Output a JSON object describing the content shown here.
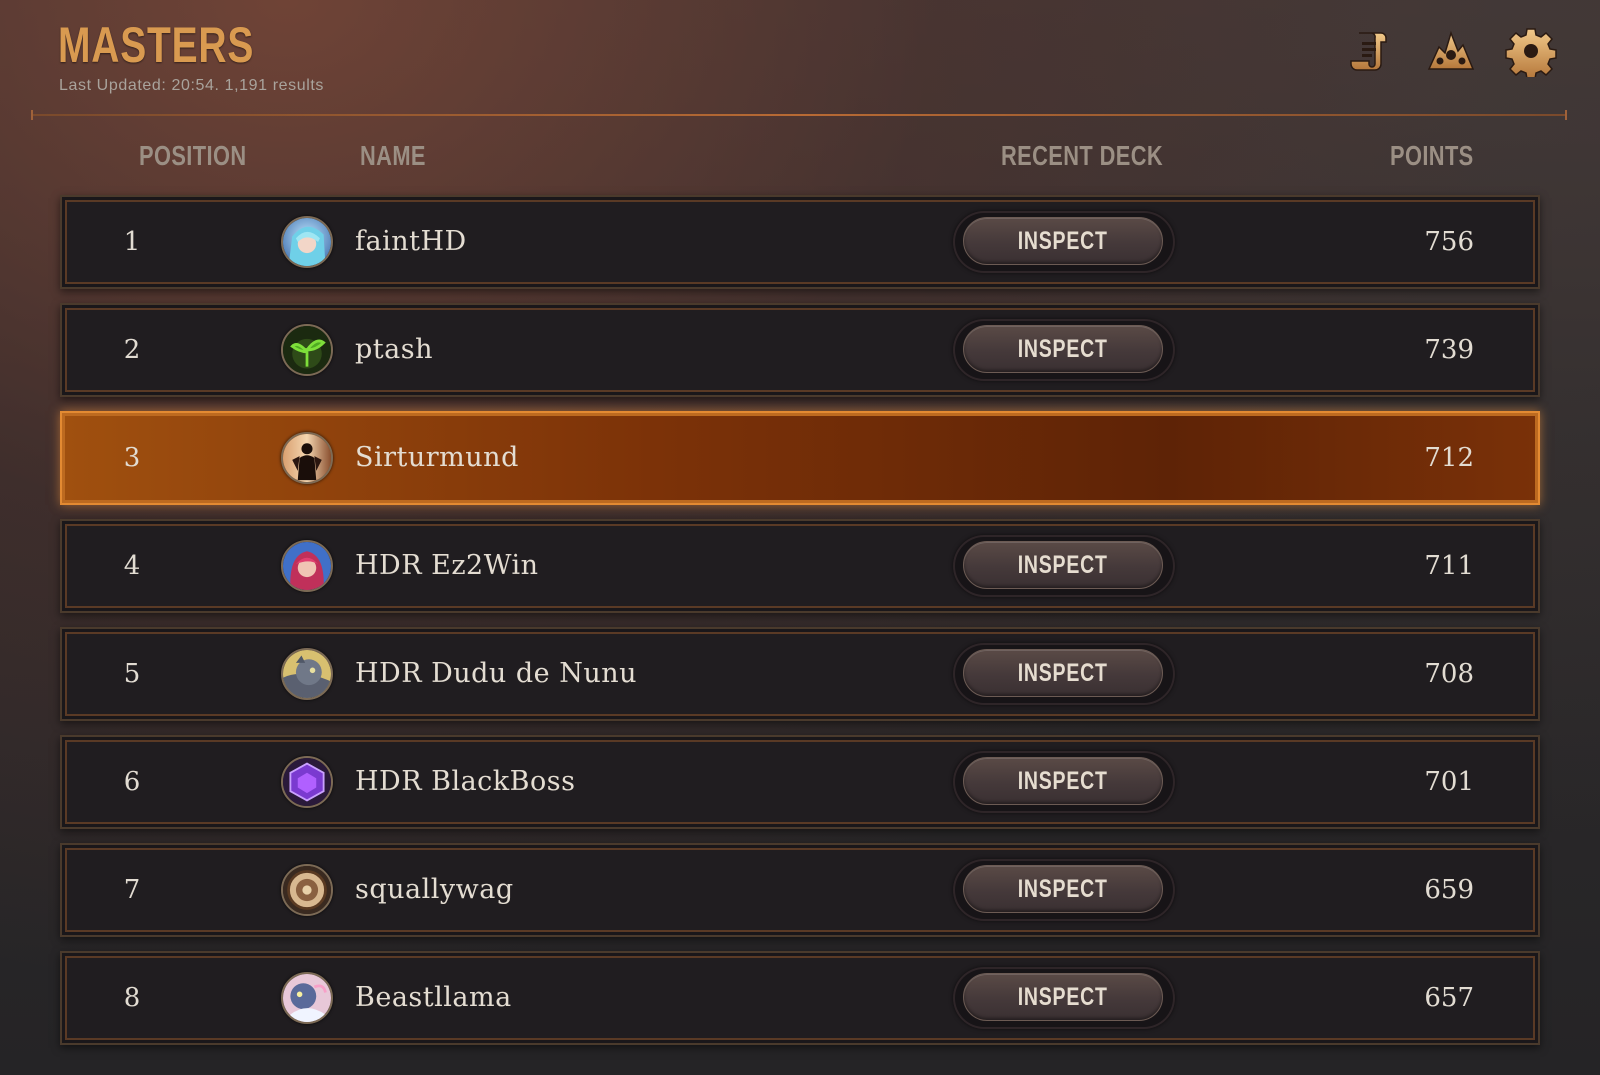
{
  "header": {
    "title": "MASTERS",
    "last_updated": "Last Updated: 20:54.",
    "results": "1,191 results",
    "icons": [
      "scroll-icon",
      "leaderboard-players-icon",
      "gear-icon"
    ]
  },
  "columns": {
    "position": "POSITION",
    "name": "NAME",
    "recent_deck": "RECENT DECK",
    "points": "POINTS"
  },
  "colors": {
    "accent": "#d99a50",
    "highlight": "#a0500f",
    "row_bg": "#201d20"
  },
  "highlighted_position": "3",
  "rows": [
    {
      "position": "1",
      "name": "faintHD",
      "points": "756",
      "action": "INSPECT",
      "avatar": "blue-haired-champion"
    },
    {
      "position": "2",
      "name": "ptash",
      "points": "739",
      "action": "INSPECT",
      "avatar": "green-sprout"
    },
    {
      "position": "3",
      "name": "Sirturmund",
      "points": "712",
      "action": "",
      "avatar": "warrior-silhouette"
    },
    {
      "position": "4",
      "name": "HDR Ez2Win",
      "points": "711",
      "action": "INSPECT",
      "avatar": "red-haired-champion"
    },
    {
      "position": "5",
      "name": "HDR Dudu de Nunu",
      "points": "708",
      "action": "INSPECT",
      "avatar": "gray-creature"
    },
    {
      "position": "6",
      "name": "HDR BlackBoss",
      "points": "701",
      "action": "INSPECT",
      "avatar": "purple-emblem"
    },
    {
      "position": "7",
      "name": "squallywag",
      "points": "659",
      "action": "INSPECT",
      "avatar": "round-badge"
    },
    {
      "position": "8",
      "name": "Beastllama",
      "points": "657",
      "action": "INSPECT",
      "avatar": "blue-creature"
    }
  ]
}
